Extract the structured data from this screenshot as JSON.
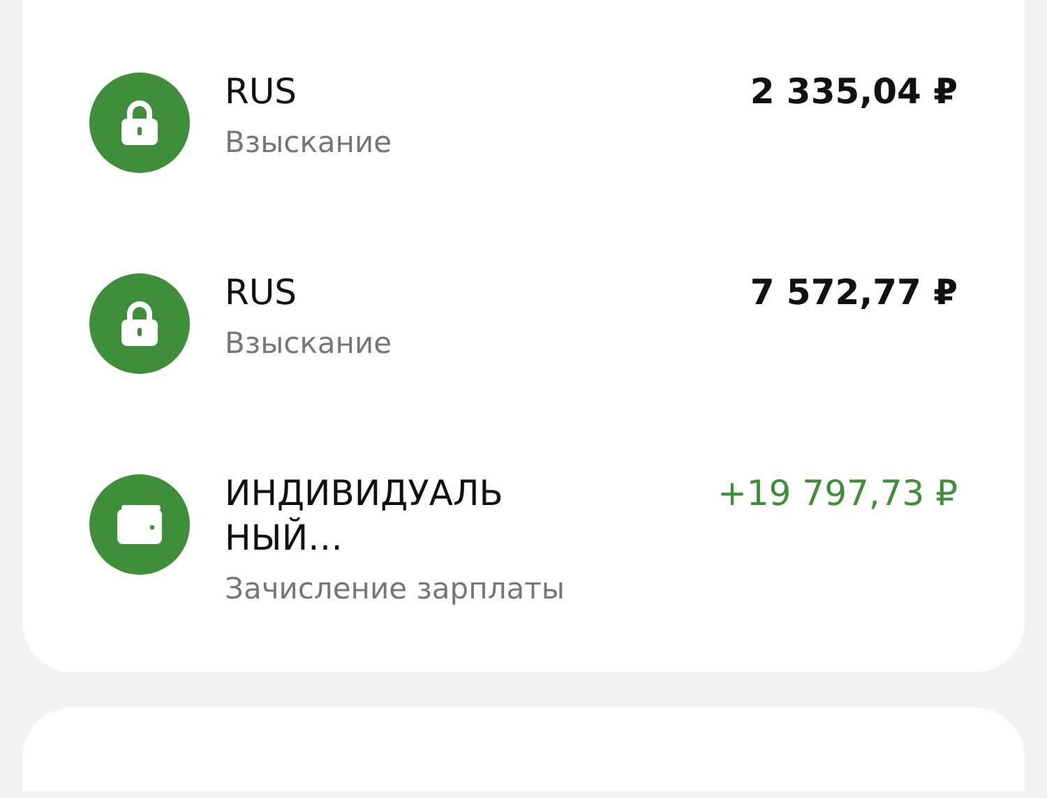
{
  "operations": [
    {
      "kind": "lock",
      "title": "RUS",
      "subtitle": "Взыскание",
      "amount": "2 335,04 ₽",
      "income": false
    },
    {
      "kind": "lock",
      "title": "RUS",
      "subtitle": "Взыскание",
      "amount": "7 572,77 ₽",
      "income": false
    },
    {
      "kind": "wallet",
      "title": "ИНДИВИДУАЛЬ\nНЫЙ…",
      "subtitle": "Зачисление зарплаты",
      "amount": "+19 797,73 ₽",
      "income": true
    }
  ]
}
